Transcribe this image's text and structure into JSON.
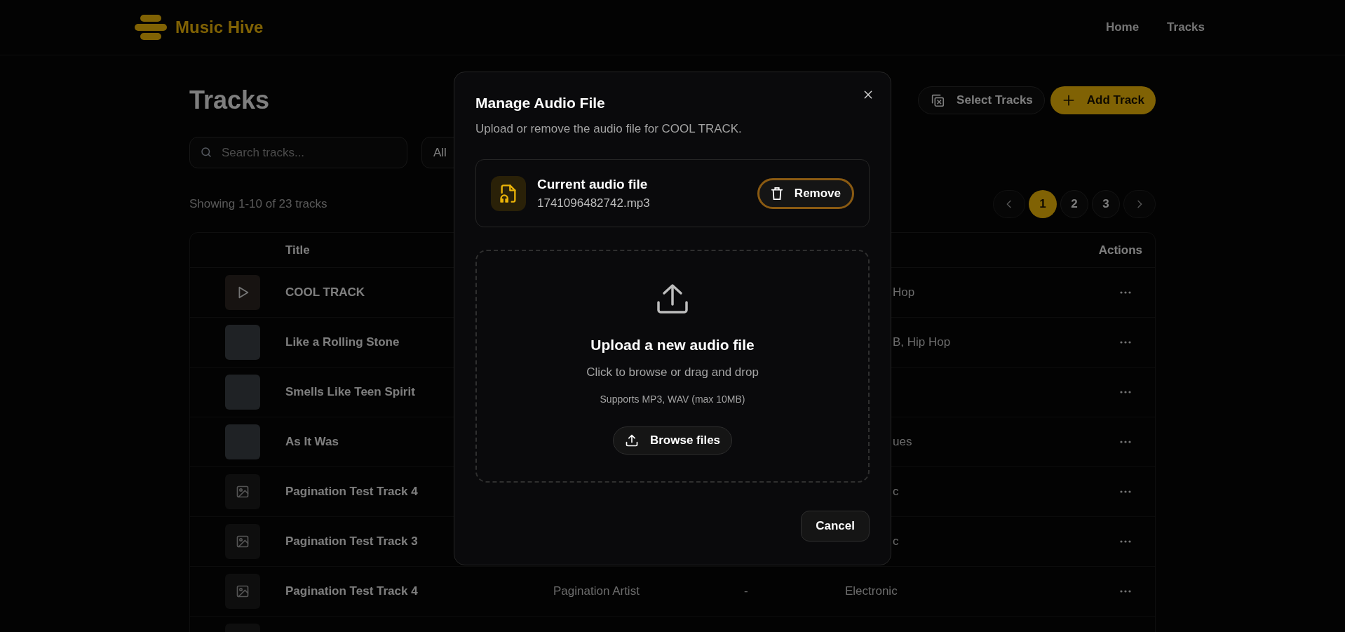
{
  "header": {
    "logo_text": "Music Hive",
    "nav": [
      {
        "label": "Home"
      },
      {
        "label": "Tracks"
      }
    ]
  },
  "page": {
    "title": "Tracks",
    "actions": [
      "Select Tracks",
      "Add Track"
    ],
    "search": {
      "placeholder": "Search tracks..."
    },
    "filter": {
      "label": "All"
    },
    "summary": "Showing 1-10 of 23 tracks",
    "pagination": [
      {
        "label": "1",
        "selected": true
      },
      {
        "label": "2",
        "selected": false
      },
      {
        "label": "3",
        "selected": false
      }
    ]
  },
  "table": {
    "columns": {
      "title": "Title",
      "actions": "Actions"
    },
    "rows": [
      {
        "kind": "photo",
        "play_overlay": true,
        "title": "COOL TRACK",
        "genre": "Hop"
      },
      {
        "kind": "photo",
        "play_overlay": false,
        "title": "Like a Rolling Stone",
        "genre": "B, Hip Hop"
      },
      {
        "kind": "photo",
        "play_overlay": false,
        "title": "Smells Like Teen Spirit"
      },
      {
        "kind": "photo",
        "play_overlay": false,
        "title": "As It Was",
        "genre": "ues"
      },
      {
        "kind": "placeholder",
        "play_overlay": false,
        "title": "Pagination Test Track 4",
        "genre": "c"
      },
      {
        "kind": "placeholder",
        "play_overlay": false,
        "title": "Pagination Test Track 3",
        "genre": "c"
      },
      {
        "kind": "placeholder",
        "play_overlay": false,
        "title": "Pagination Test Track 4",
        "artist": "Pagination Artist",
        "album": "-",
        "genre": "Electronic"
      },
      {
        "kind": "placeholder"
      }
    ]
  },
  "dialog": {
    "title": "Manage Audio File",
    "description": "Upload or remove the audio file for COOL TRACK.",
    "current_file": {
      "label": "Current audio file",
      "filename": "1741096482742.mp3",
      "remove_button": "Remove"
    },
    "dropzone": {
      "heading": "Upload a new audio file",
      "hint": "Click to browse or drag and drop",
      "formats": "Supports MP3, WAV (max 10MB)",
      "button": "Browse files"
    },
    "cancel_button": "Cancel"
  }
}
